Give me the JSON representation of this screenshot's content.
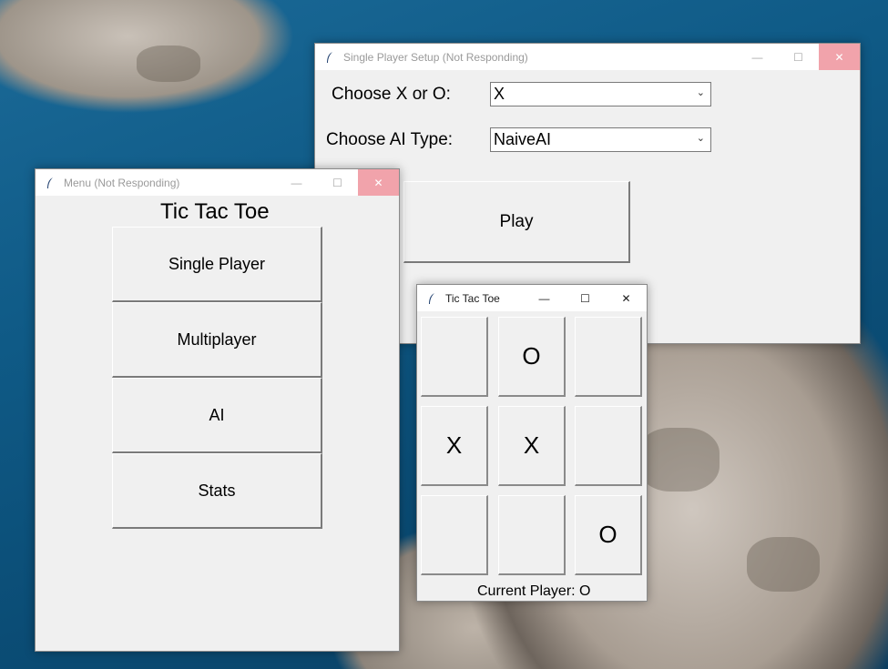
{
  "setup_window": {
    "title": "Single Player Setup (Not Responding)",
    "choose_symbol_label": "Choose X or O:",
    "symbol_value": "X",
    "choose_ai_label": "Choose AI Type:",
    "ai_value": "NaiveAI",
    "play_label": "Play"
  },
  "menu_window": {
    "title": "Menu (Not Responding)",
    "heading": "Tic Tac Toe",
    "buttons": [
      "Single Player",
      "Multiplayer",
      "AI",
      "Stats"
    ]
  },
  "game_window": {
    "title": "Tic Tac Toe",
    "board": [
      "",
      "O",
      "",
      "X",
      "X",
      "",
      "",
      "",
      "O"
    ],
    "status": "Current Player: O"
  },
  "titlebar_glyphs": {
    "minimize": "—",
    "maximize": "☐",
    "close": "✕"
  },
  "colors": {
    "window_bg": "#f0f0f0",
    "titlebar_bg": "#ffffff",
    "close_inactive": "#f1a3ab"
  }
}
